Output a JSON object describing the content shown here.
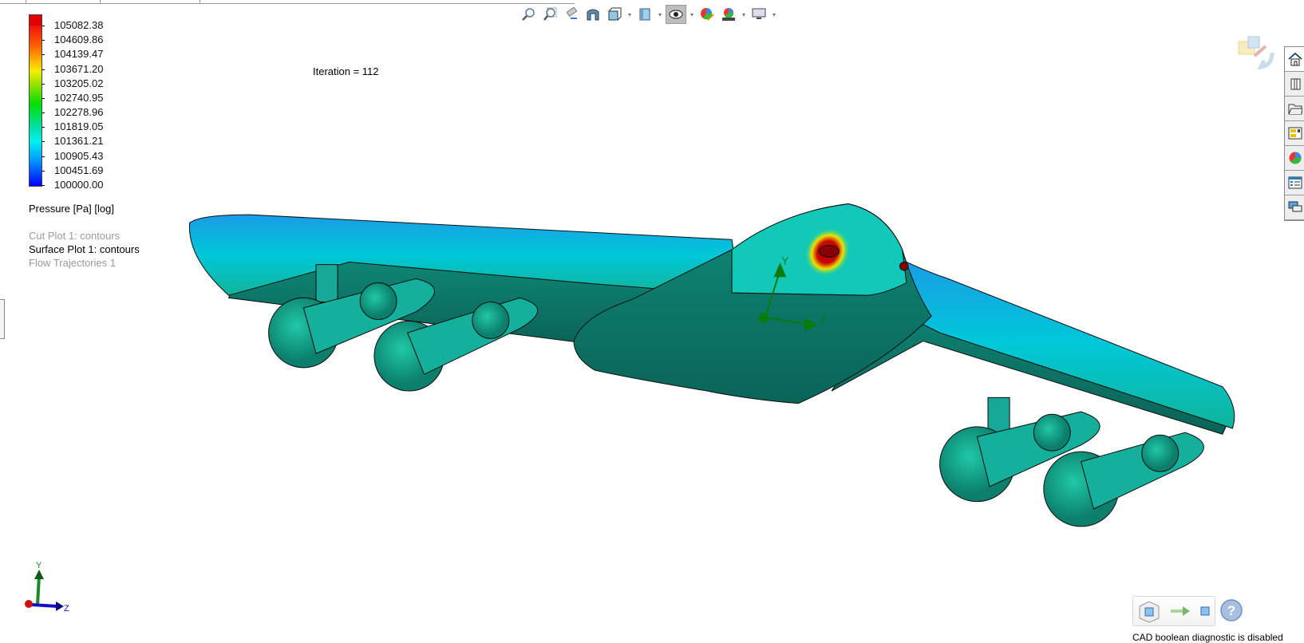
{
  "legend": {
    "values": [
      "105082.38",
      "104609.86",
      "104139.47",
      "103671.20",
      "103205.02",
      "102740.95",
      "102278.96",
      "101819.05",
      "101361.21",
      "100905.43",
      "100451.69",
      "100000.00"
    ],
    "title": "Pressure [Pa] [log]",
    "plots": [
      {
        "label": "Cut Plot 1: contours",
        "active": false
      },
      {
        "label": "Surface Plot 1: contours",
        "active": true
      },
      {
        "label": "Flow Trajectories 1",
        "active": false
      }
    ]
  },
  "iteration_label": "Iteration = 112",
  "toolbar": {
    "icons": [
      "zoom-to-fit-icon",
      "zoom-to-area-icon",
      "previous-view-icon",
      "section-view-icon",
      "view-orientation-icon",
      "display-style-icon",
      "hide-show-items-icon",
      "edit-appearance-icon",
      "apply-scene-icon",
      "view-settings-icon"
    ]
  },
  "right_panel": {
    "icons": [
      "home-icon",
      "design-library-icon",
      "file-explorer-icon",
      "view-palette-icon",
      "appearances-icon",
      "custom-properties-icon",
      "forum-icon"
    ]
  },
  "triad": {
    "y": "Y",
    "z": "Z"
  },
  "model_triad": {
    "y": "Y",
    "z": "Z"
  },
  "cad_status": "CAD boolean diagnostic is disabled",
  "colors": {
    "high": "#e00000",
    "low": "#0000ff",
    "surface": "#10b4c8",
    "underside": "#0d6e62"
  }
}
